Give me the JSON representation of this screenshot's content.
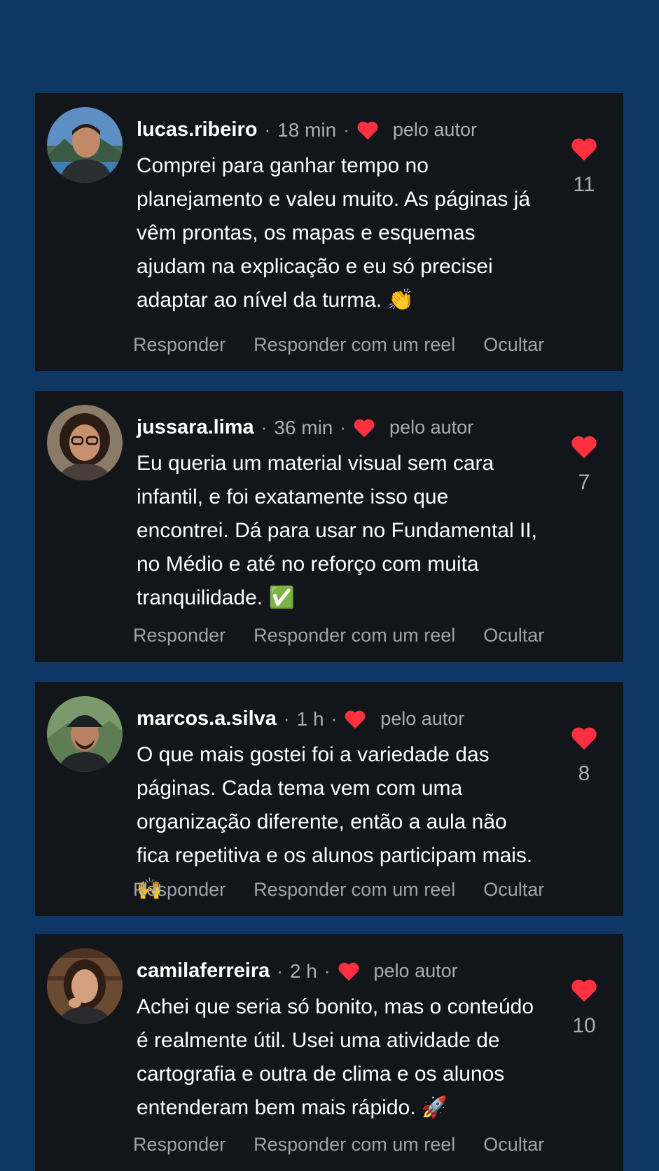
{
  "comments": [
    {
      "username": "lucas.ribeiro",
      "time": "18 min",
      "by_author": "pelo autor",
      "text": "Comprei para ganhar tempo no planejamento e valeu muito. As páginas já vêm prontas, os mapas e esquemas ajudam na explicação e eu só precisei adaptar ao nível da turma.",
      "emoji": "👏",
      "likes": "11",
      "actions": {
        "reply": "Responder",
        "reply_reel": "Responder com um reel",
        "hide": "Ocultar"
      }
    },
    {
      "username": "jussara.lima",
      "time": "36 min",
      "by_author": "pelo autor",
      "text": "Eu queria um material visual sem cara infantil, e foi exatamente isso que encontrei. Dá para usar no Fundamental II, no Médio e até no reforço com muita tranquilidade.",
      "emoji": "✅",
      "likes": "7",
      "actions": {
        "reply": "Responder",
        "reply_reel": "Responder com um reel",
        "hide": "Ocultar"
      }
    },
    {
      "username": "marcos.a.silva",
      "time": "1 h",
      "by_author": "pelo autor",
      "text": "O que mais gostei foi a variedade das páginas. Cada tema vem com uma organização diferente, então a aula não fica repetitiva e os alunos participam mais.",
      "emoji": "🙌",
      "likes": "8",
      "actions": {
        "reply": "Responder",
        "reply_reel": "Responder com um reel",
        "hide": "Ocultar"
      }
    },
    {
      "username": "camilaferreira",
      "time": "2 h",
      "by_author": "pelo autor",
      "text": "Achei que seria só bonito, mas o conteúdo é realmente útil. Usei uma atividade de cartografia e outra de clima e os alunos entenderam bem mais rápido.",
      "emoji": "🚀",
      "likes": "10",
      "actions": {
        "reply": "Responder",
        "reply_reel": "Responder com um reel",
        "hide": "Ocultar"
      }
    }
  ],
  "colors": {
    "background": "#0f3766",
    "card": "#121519",
    "heart": "#ff3040",
    "muted": "#a9aeb4"
  },
  "icons": {
    "author_like": "heart-icon",
    "like": "heart-icon"
  }
}
